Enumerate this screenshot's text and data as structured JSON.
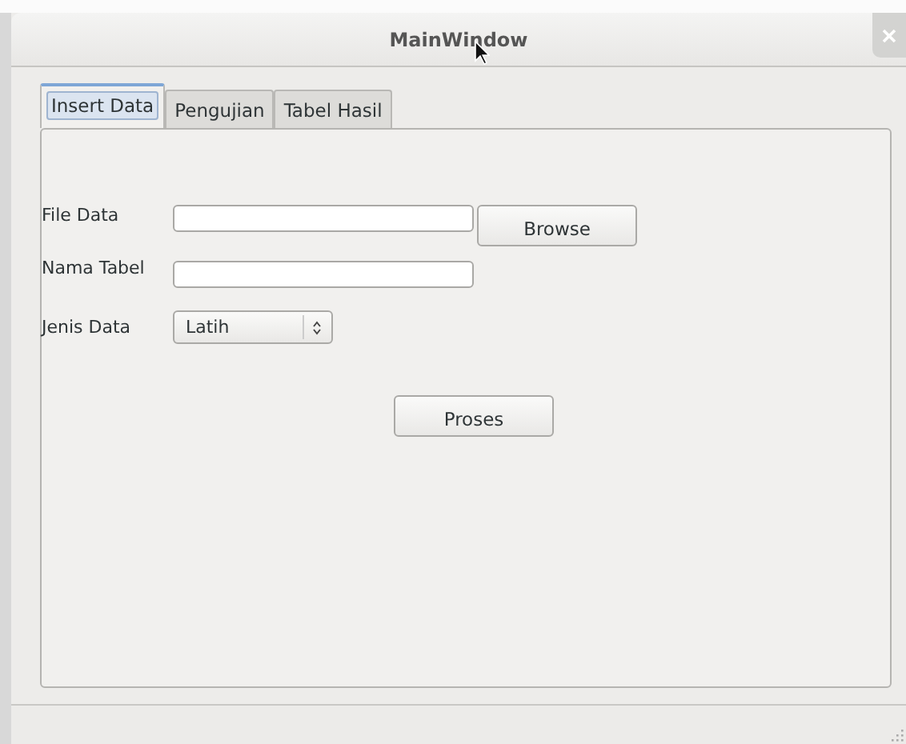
{
  "window": {
    "title": "MainWindow"
  },
  "tabs": [
    {
      "label": "Insert Data",
      "selected": true
    },
    {
      "label": "Pengujian",
      "selected": false
    },
    {
      "label": "Tabel Hasil",
      "selected": false
    }
  ],
  "form": {
    "file_data": {
      "label": "File Data"
    },
    "browse_button": "Browse",
    "nama_tabel": {
      "label": "Nama Tabel"
    },
    "jenis_data": {
      "label": "Jenis Data",
      "value": "Latih"
    },
    "proses_button": "Proses"
  }
}
